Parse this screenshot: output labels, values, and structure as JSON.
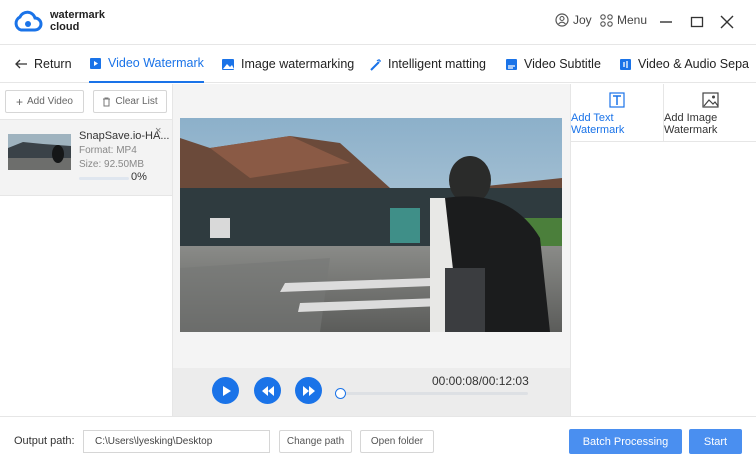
{
  "app": {
    "name_line1": "watermark",
    "name_line2": "cloud"
  },
  "header": {
    "user": "Joy",
    "menu": "Menu"
  },
  "nav": {
    "return_label": "Return",
    "tabs": [
      {
        "label": "Video Watermark"
      },
      {
        "label": "Image watermarking"
      },
      {
        "label": "Intelligent matting"
      },
      {
        "label": "Video Subtitle"
      },
      {
        "label": "Video & Audio Sepa"
      }
    ]
  },
  "left": {
    "add_video": "Add Video",
    "clear_list": "Clear List",
    "file": {
      "name": "SnapSave.io-HA...",
      "format": "Format:  MP4",
      "size": "Size:  92.50MB",
      "progress": "0%",
      "progress_value": 0
    }
  },
  "player": {
    "time": "00:00:08/00:12:03",
    "progress_value": 0.011
  },
  "right": {
    "text_wm_line1": "Add Text",
    "text_wm_line2": "Watermark",
    "image_wm_line1": "Add Image",
    "image_wm_line2": "Watermark"
  },
  "bottom": {
    "output_label": "Output path:",
    "path": "C:\\Users\\lyesking\\Desktop",
    "change_path": "Change path",
    "open_folder": "Open folder",
    "batch": "Batch Processing",
    "start": "Start"
  },
  "colors": {
    "accent": "#1a73e8",
    "button": "#4a8ff0"
  }
}
